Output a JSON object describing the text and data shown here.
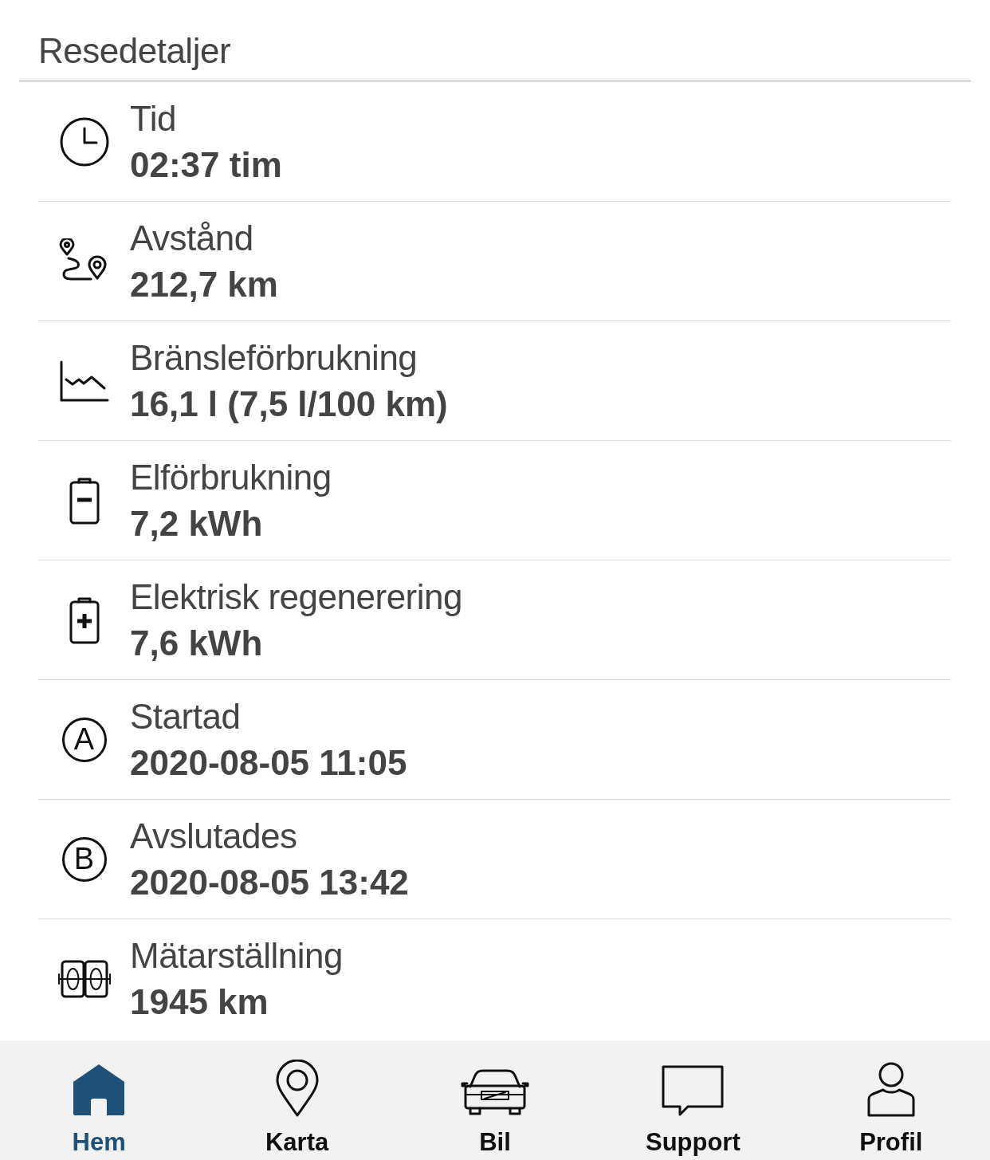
{
  "header": {
    "title": "Resedetaljer"
  },
  "details": [
    {
      "kind": "clock",
      "label": "Tid",
      "value": "02:37 tim"
    },
    {
      "kind": "route",
      "label": "Avstånd",
      "value": "212,7 km"
    },
    {
      "kind": "graph",
      "label": "Bränsleförbrukning",
      "value": "16,1 l (7,5 l/100 km)"
    },
    {
      "kind": "battery-minus",
      "label": "Elförbrukning",
      "value": "7,2 kWh"
    },
    {
      "kind": "battery-plus",
      "label": "Elektrisk regenerering",
      "value": "7,6 kWh"
    },
    {
      "kind": "letter",
      "badge": "A",
      "label": "Startad",
      "value": "2020-08-05 11:05"
    },
    {
      "kind": "letter",
      "badge": "B",
      "label": "Avslutades",
      "value": "2020-08-05 13:42"
    },
    {
      "kind": "odometer",
      "label": "Mätarställning",
      "value": "1945 km"
    }
  ],
  "tabs": [
    {
      "kind": "home",
      "label": "Hem",
      "selected": true
    },
    {
      "kind": "map",
      "label": "Karta",
      "selected": false
    },
    {
      "kind": "car",
      "label": "Bil",
      "selected": false
    },
    {
      "kind": "chat",
      "label": "Support",
      "selected": false
    },
    {
      "kind": "profile",
      "label": "Profil",
      "selected": false
    }
  ]
}
